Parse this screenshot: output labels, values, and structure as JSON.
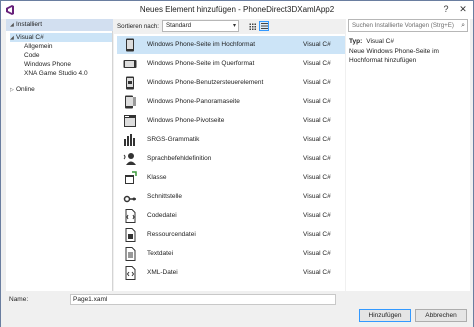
{
  "window": {
    "title": "Neues Element hinzufügen - PhoneDirect3DXamlApp2",
    "help_glyph": "?",
    "close_glyph": "✕"
  },
  "left_pane": {
    "header": "Installiert",
    "tree": [
      {
        "label": "Visual C#",
        "expander": "◢",
        "selected": true
      },
      {
        "label": "Allgemein",
        "expander": ""
      },
      {
        "label": "Code",
        "expander": ""
      },
      {
        "label": "Windows Phone",
        "expander": ""
      },
      {
        "label": "XNA Game Studio 4.0",
        "expander": ""
      },
      {
        "label": "Online",
        "expander": "▷"
      }
    ]
  },
  "toolbar": {
    "sort_label": "Sortieren nach:",
    "sort_value": "Standard",
    "chevron": "▾"
  },
  "templates": [
    {
      "name": "Windows Phone-Seite im Hochformat",
      "lang": "Visual C#",
      "icon": "phone-portrait-icon",
      "selected": true
    },
    {
      "name": "Windows Phone-Seite im Querformat",
      "lang": "Visual C#",
      "icon": "phone-landscape-icon"
    },
    {
      "name": "Windows Phone-Benutzersteuerelement",
      "lang": "Visual C#",
      "icon": "phone-usercontrol-icon"
    },
    {
      "name": "Windows Phone-Panoramaseite",
      "lang": "Visual C#",
      "icon": "phone-panorama-icon"
    },
    {
      "name": "Windows Phone-Pivotseite",
      "lang": "Visual C#",
      "icon": "phone-pivot-icon"
    },
    {
      "name": "SRGS-Grammatik",
      "lang": "Visual C#",
      "icon": "srgs-grammar-icon"
    },
    {
      "name": "Sprachbefehldefinition",
      "lang": "Visual C#",
      "icon": "voice-command-icon"
    },
    {
      "name": "Klasse",
      "lang": "Visual C#",
      "icon": "class-icon"
    },
    {
      "name": "Schnittstelle",
      "lang": "Visual C#",
      "icon": "interface-icon"
    },
    {
      "name": "Codedatei",
      "lang": "Visual C#",
      "icon": "code-file-icon"
    },
    {
      "name": "Ressourcendatei",
      "lang": "Visual C#",
      "icon": "resource-file-icon"
    },
    {
      "name": "Textdatei",
      "lang": "Visual C#",
      "icon": "text-file-icon"
    },
    {
      "name": "XML-Datei",
      "lang": "Visual C#",
      "icon": "xml-file-icon"
    }
  ],
  "details": {
    "search_placeholder": "Suchen Installierte Vorlagen (Strg+E)",
    "search_glyph": "⌕",
    "type_label": "Typ:",
    "type_value": "Visual C#",
    "description": "Neue Windows Phone-Seite im Hochformat hinzufügen"
  },
  "footer": {
    "name_label": "Name:",
    "name_value": "Page1.xaml",
    "add_button": "Hinzufügen",
    "cancel_button": "Abbrechen"
  },
  "colors": {
    "selection": "#cce4f7",
    "header": "#d2dff0",
    "accent": "#3399ff"
  }
}
